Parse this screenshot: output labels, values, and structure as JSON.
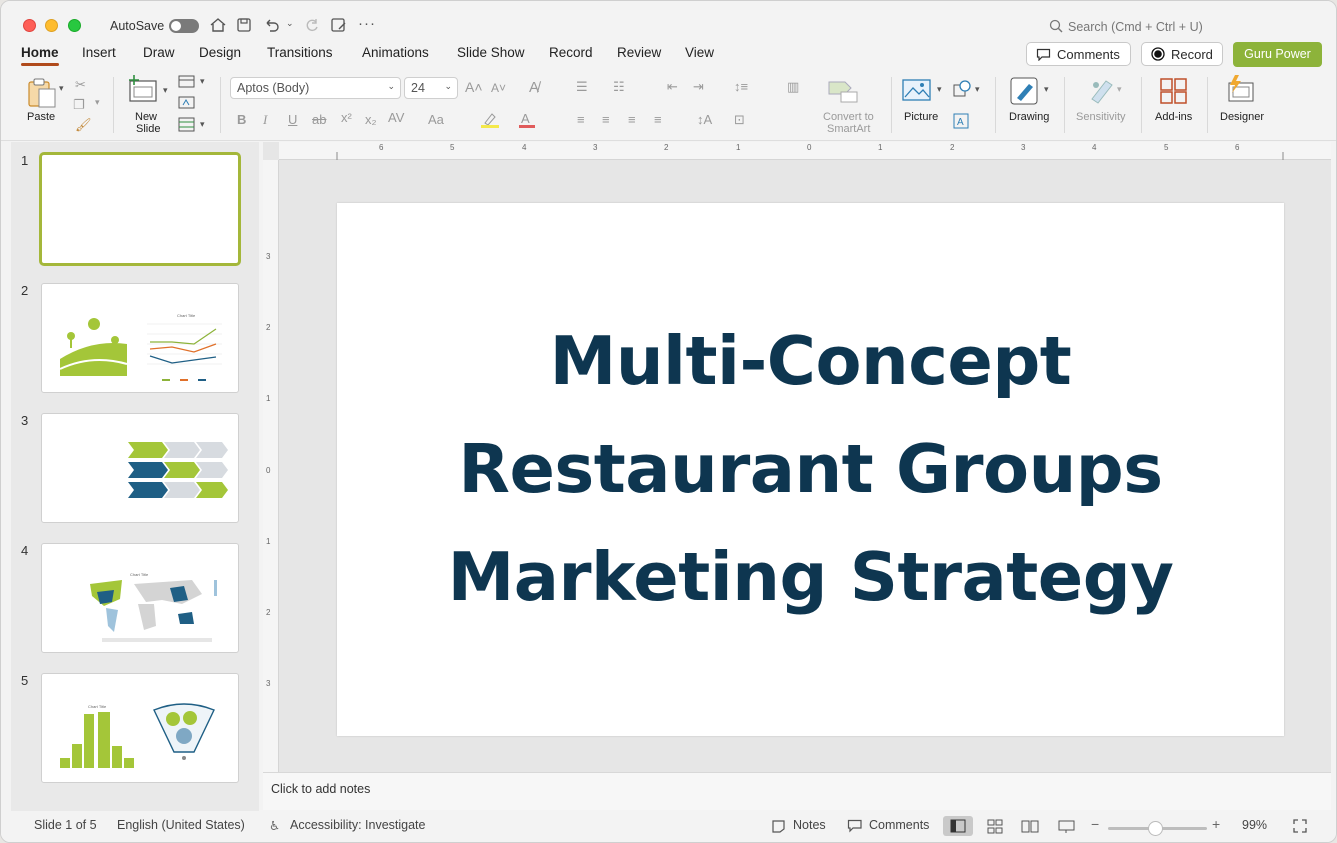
{
  "titlebar": {
    "autosave_label": "AutoSave",
    "search_placeholder": "Search (Cmd + Ctrl + U)"
  },
  "tabs": [
    "Home",
    "Insert",
    "Draw",
    "Design",
    "Transitions",
    "Animations",
    "Slide Show",
    "Record",
    "Review",
    "View"
  ],
  "actions": {
    "comments": "Comments",
    "record": "Record",
    "guru": "Guru Power"
  },
  "ribbon": {
    "paste": "Paste",
    "new_slide_1": "New",
    "new_slide_2": "Slide",
    "font_name": "Aptos (Body)",
    "font_size": "24",
    "convert_1": "Convert to",
    "convert_2": "SmartArt",
    "picture": "Picture",
    "drawing": "Drawing",
    "sensitivity": "Sensitivity",
    "addins": "Add-ins",
    "designer": "Designer"
  },
  "ruler_h": [
    "6",
    "5",
    "4",
    "3",
    "2",
    "1",
    "0",
    "1",
    "2",
    "3",
    "4",
    "5",
    "6"
  ],
  "ruler_v": [
    "3",
    "2",
    "1",
    "0",
    "1",
    "2",
    "3"
  ],
  "thumbnails": [
    "1",
    "2",
    "3",
    "4",
    "5"
  ],
  "slide": {
    "line1": "Multi-Concept",
    "line2": "Restaurant Groups",
    "line3": "Marketing Strategy"
  },
  "notes_placeholder": "Click to add notes",
  "status": {
    "slide_count": "Slide 1 of 5",
    "language": "English (United States)",
    "accessibility": "Accessibility: Investigate",
    "notes": "Notes",
    "comments": "Comments",
    "zoom": "99%"
  },
  "colors": {
    "accent_tab": "#b04a1b",
    "guru_green": "#8db33a",
    "title_navy": "#0e3650",
    "thumb_green": "#a4c639",
    "thumb_blue": "#1f5f85"
  }
}
